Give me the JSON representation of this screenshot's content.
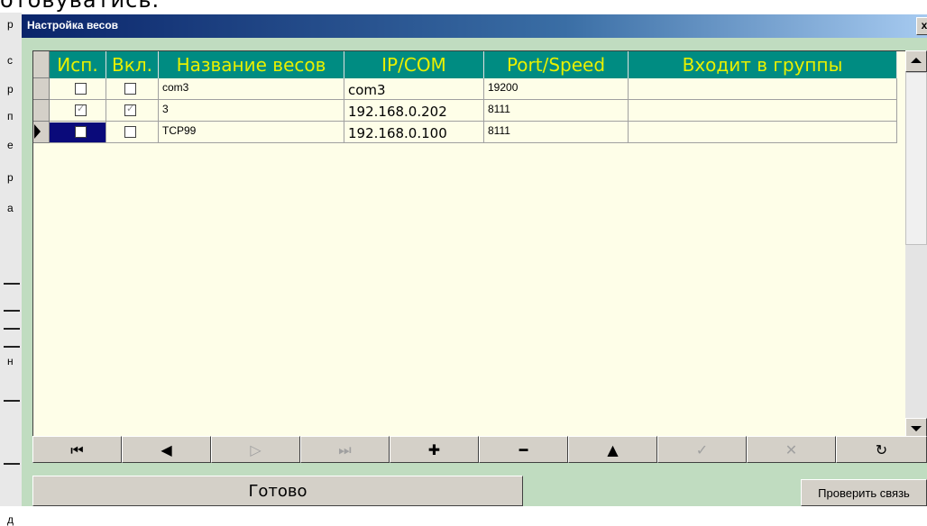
{
  "background": {
    "top_text": "отовуватись.",
    "left_letters": [
      "р",
      "с",
      "р",
      "п",
      "е",
      "р",
      "а",
      "н",
      "д"
    ]
  },
  "dialog": {
    "title": "Настройка весов",
    "close_label": "x"
  },
  "grid": {
    "columns": [
      "Исп.",
      "Вкл.",
      "Название весов",
      "IP/COM",
      "Port/Speed",
      "Входит в группы"
    ],
    "rows": [
      {
        "isp": false,
        "vkl": false,
        "name": "com3",
        "ip": "com3",
        "port": "19200",
        "groups": ""
      },
      {
        "isp": true,
        "vkl": true,
        "name": "3",
        "ip": "192.168.0.202",
        "port": "8111",
        "groups": ""
      },
      {
        "isp": false,
        "vkl": false,
        "name": "TCP99",
        "ip": "192.168.0.100",
        "port": "8111",
        "groups": ""
      }
    ],
    "selected_row": 2
  },
  "navigator": {
    "buttons": [
      {
        "icon": "first-record-icon",
        "glyph": "⏮",
        "enabled": true
      },
      {
        "icon": "prior-record-icon",
        "glyph": "◀",
        "enabled": true
      },
      {
        "icon": "next-record-icon",
        "glyph": "▷",
        "enabled": false
      },
      {
        "icon": "last-record-icon",
        "glyph": "⏭",
        "enabled": false
      },
      {
        "icon": "insert-record-icon",
        "glyph": "✚",
        "enabled": true
      },
      {
        "icon": "delete-record-icon",
        "glyph": "━",
        "enabled": true
      },
      {
        "icon": "edit-record-icon",
        "glyph": "▲",
        "enabled": true
      },
      {
        "icon": "post-record-icon",
        "glyph": "✓",
        "enabled": false
      },
      {
        "icon": "cancel-record-icon",
        "glyph": "✕",
        "enabled": false
      },
      {
        "icon": "refresh-record-icon",
        "glyph": "↻",
        "enabled": true
      }
    ]
  },
  "buttons": {
    "ok_label": "Готово",
    "check_label": "Проверить связь"
  },
  "colors": {
    "dialog_bg": "#c0dcc0",
    "header_bg": "#008c82",
    "header_text": "#e8f000",
    "grid_bg": "#fefee8"
  }
}
